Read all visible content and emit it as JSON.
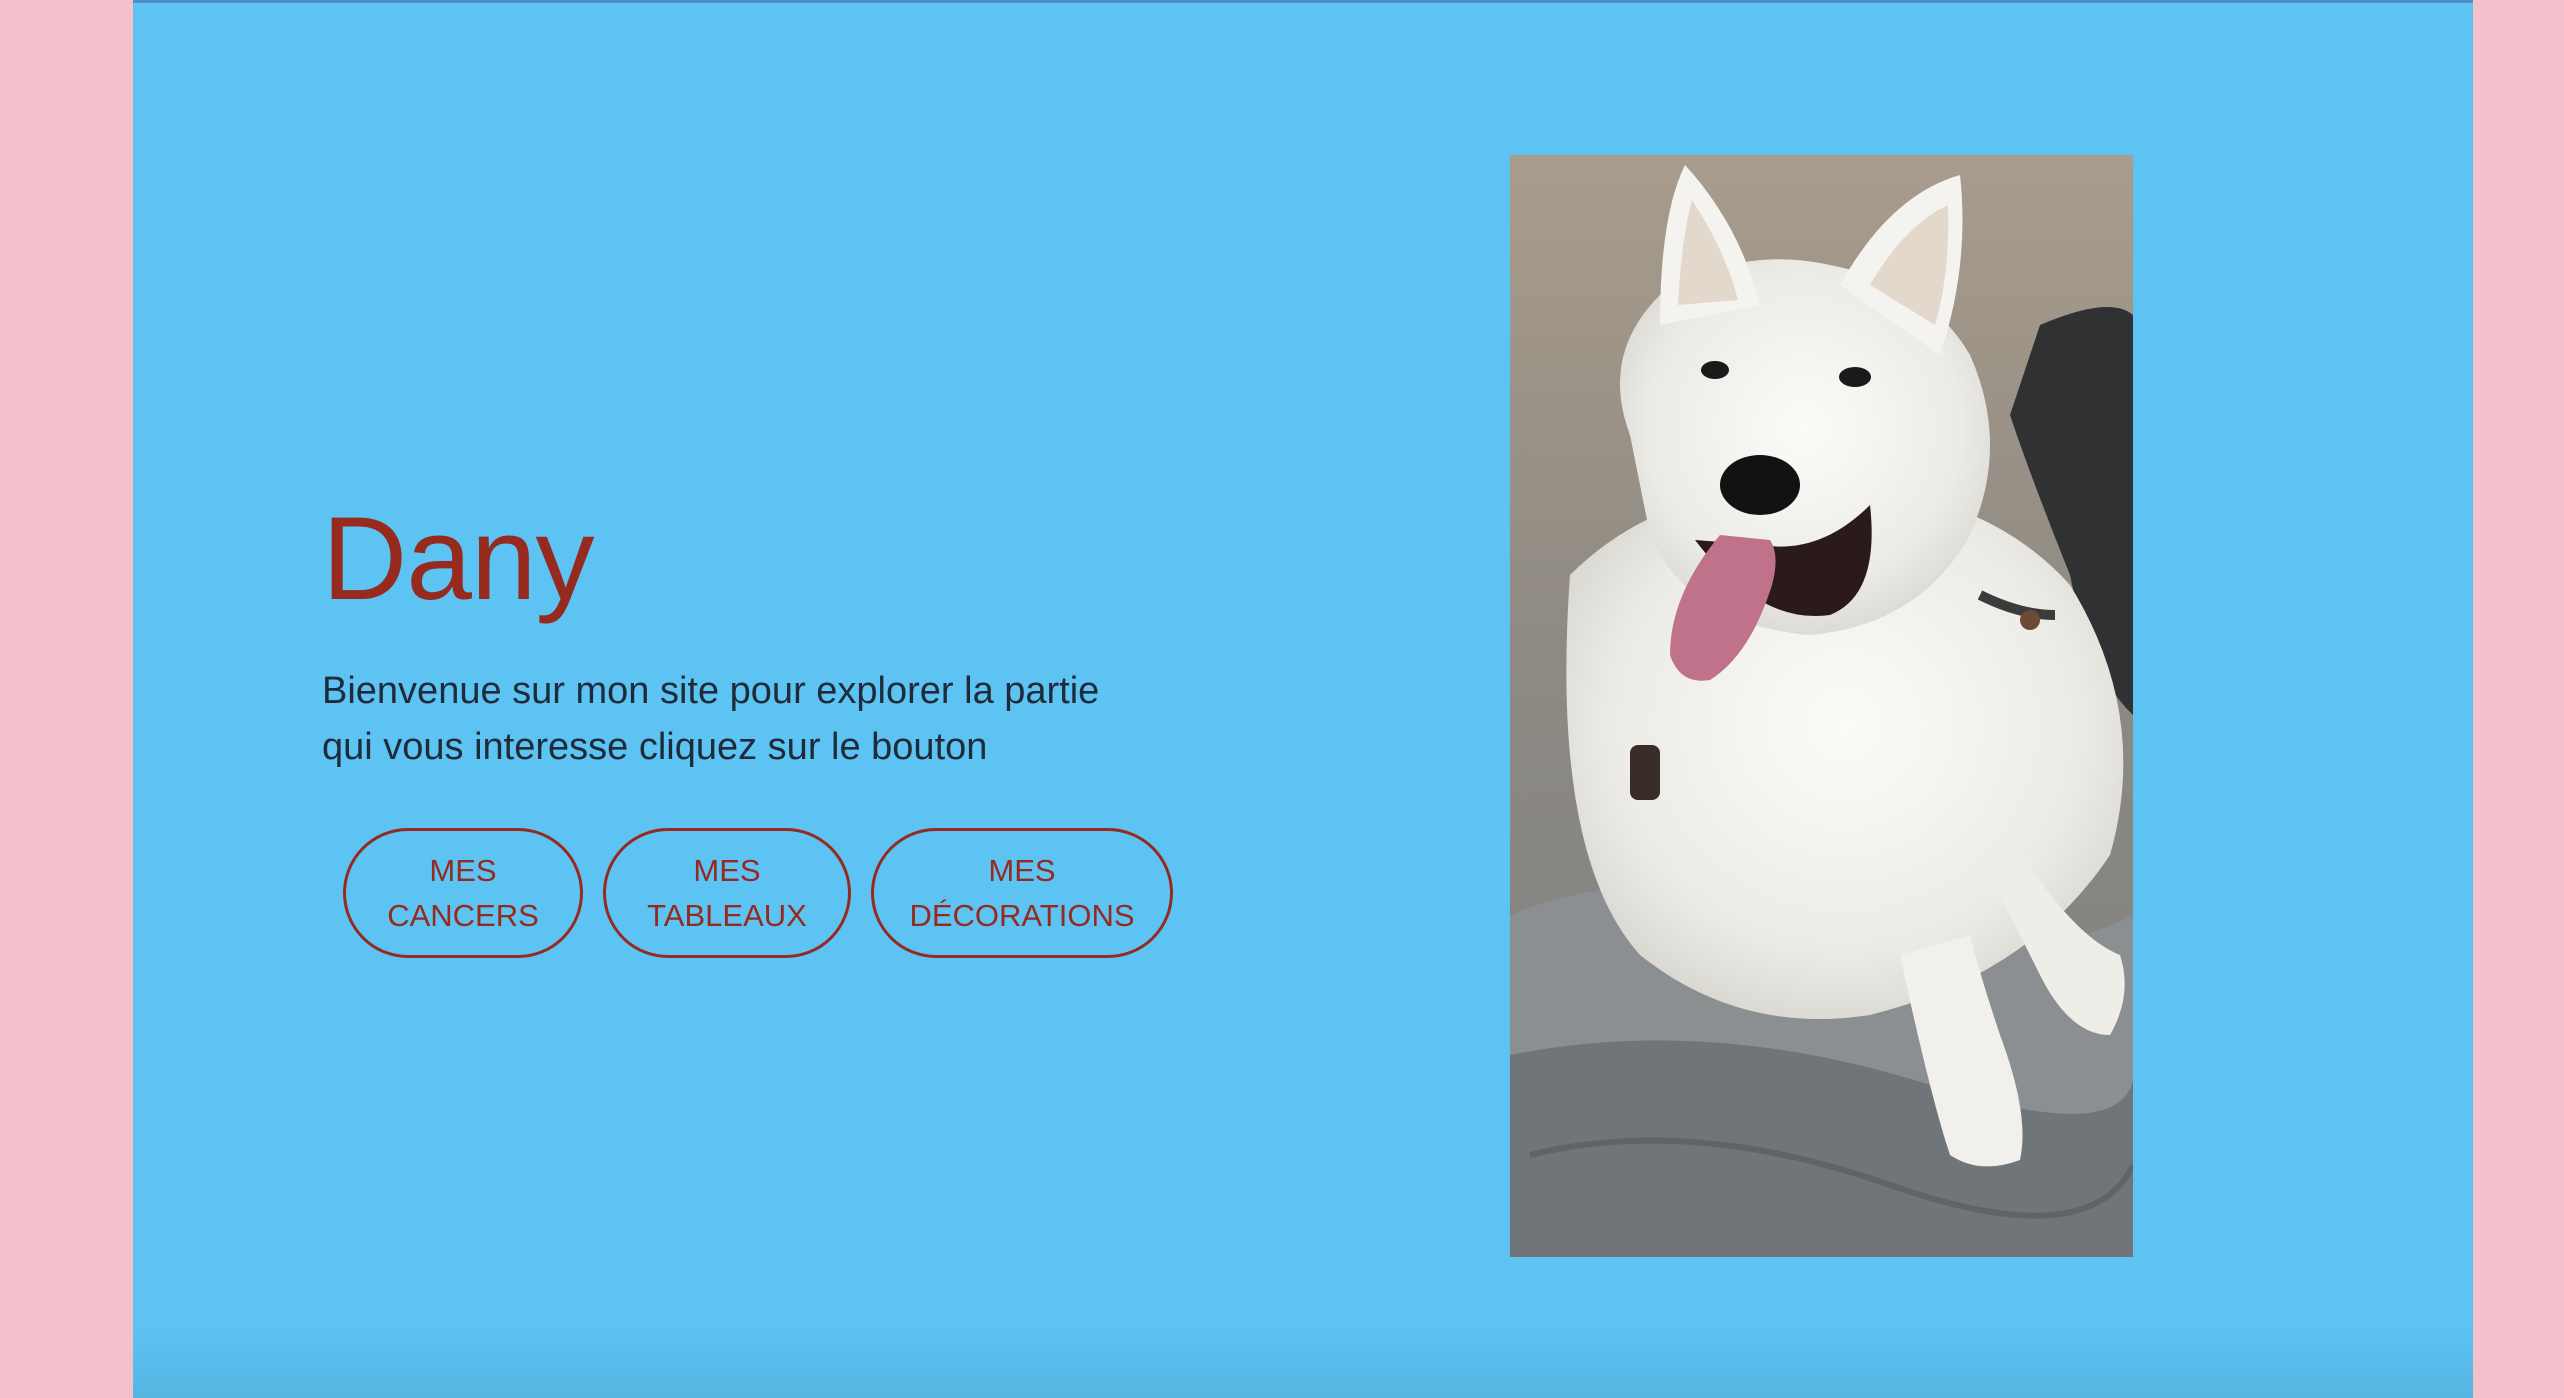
{
  "colors": {
    "page_side": "#f4c0cb",
    "hero_bg": "#5cc3f3",
    "accent": "#962a1f",
    "text": "#1f2b38"
  },
  "hero": {
    "title": "Dany",
    "intro": "Bienvenue sur mon site pour explorer la partie qui vous interesse cliquez sur le bouton",
    "buttons": [
      {
        "line1": "MES",
        "line2": "CANCERS"
      },
      {
        "line1": "MES",
        "line2": "TABLEAUX"
      },
      {
        "line1": "MES",
        "line2": "DÉCORATIONS"
      }
    ],
    "photo": {
      "icon": "dog-photo"
    }
  }
}
